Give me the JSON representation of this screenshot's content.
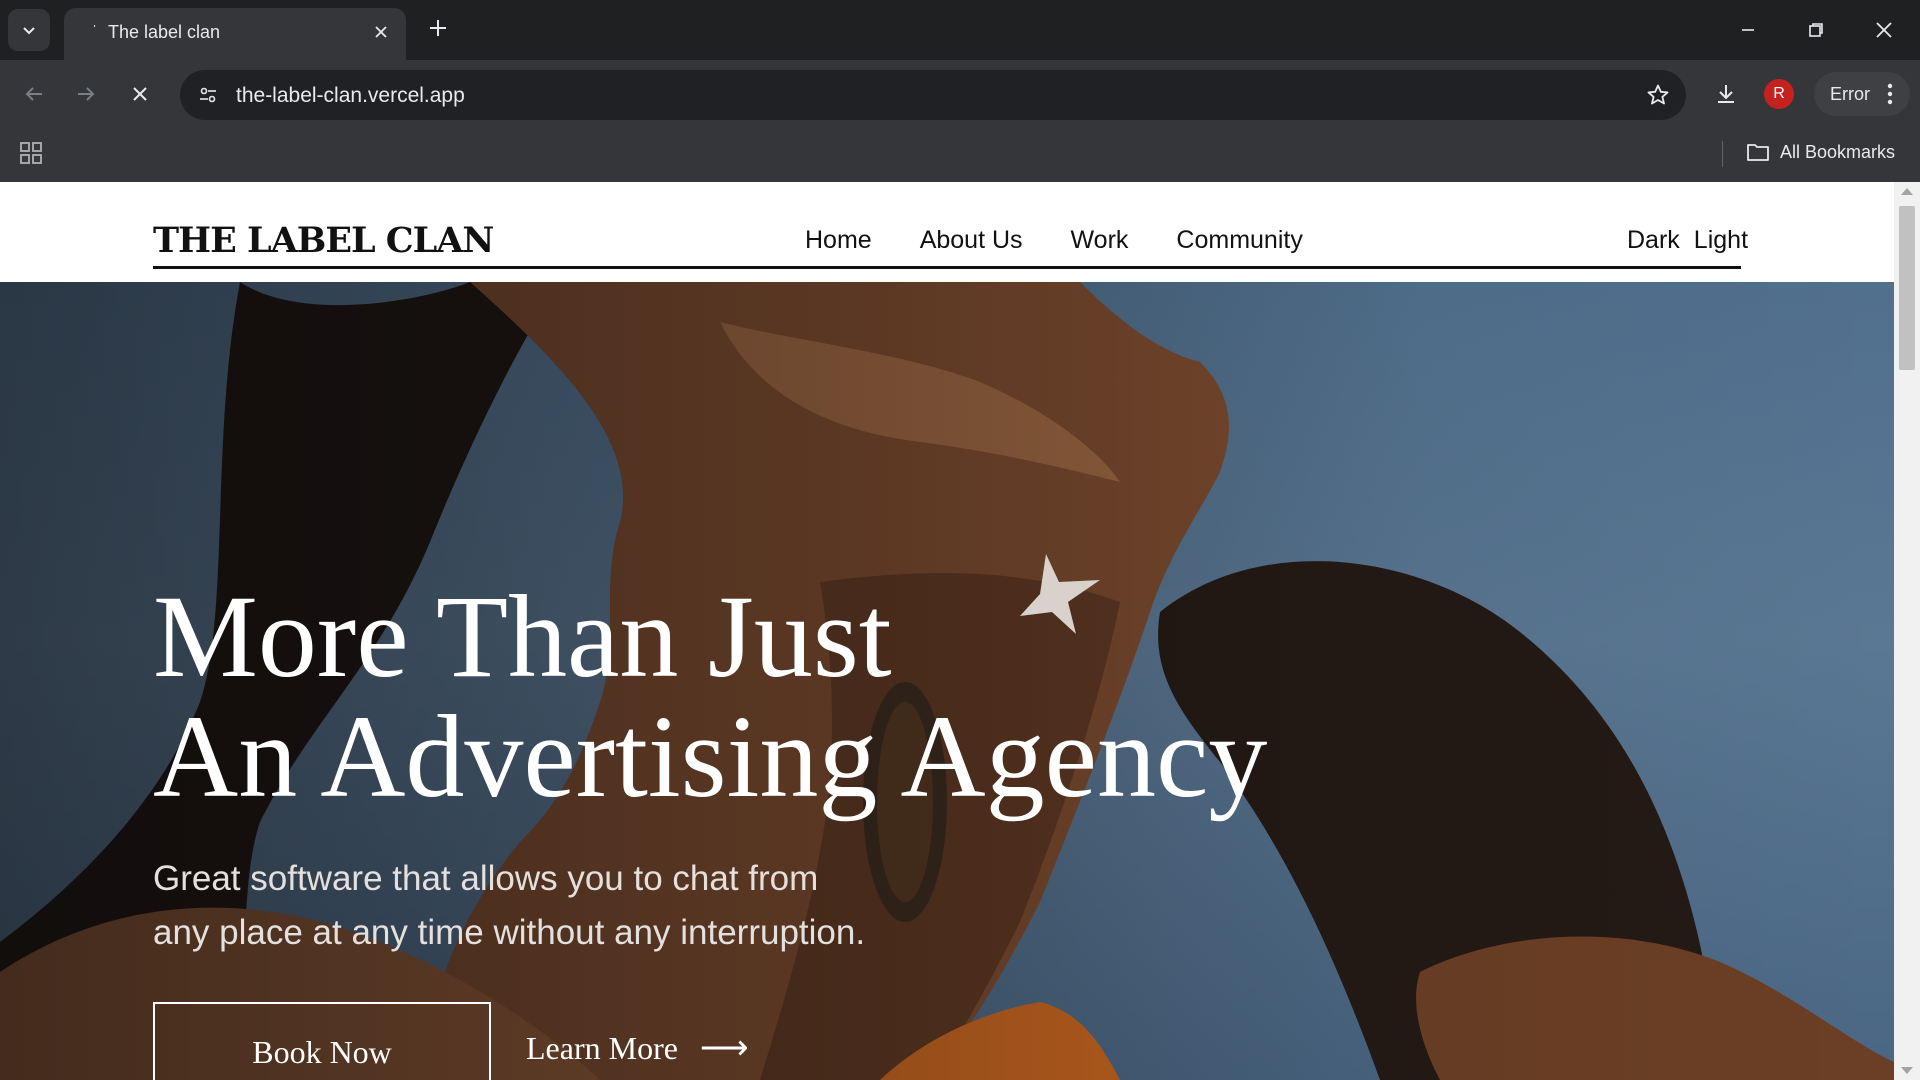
{
  "browser": {
    "tab_title": "The label clan",
    "url": "the-label-clan.vercel.app",
    "profile_initial": "R",
    "profile_status": "Error",
    "bookmarks_label": "All Bookmarks"
  },
  "site": {
    "logo": "THE LABEL CLAN",
    "nav": [
      "Home",
      "About Us",
      "Work",
      "Community"
    ],
    "theme": {
      "dark": "Dark",
      "light": "Light"
    }
  },
  "hero": {
    "headline_line1": "More Than Just",
    "headline_line2": "An Advertising Agency",
    "subtext_line1": "Great software that allows you to chat from",
    "subtext_line2": "any place at any time without any interruption.",
    "book_button": "Book Now",
    "learn_link": "Learn More",
    "learn_arrow": "⟶"
  },
  "colors": {
    "chrome_dark": "#202124",
    "chrome_toolbar": "#35363a",
    "hero_sky": "#5a7793",
    "text_dark": "#111111",
    "text_light": "#ffffff"
  }
}
